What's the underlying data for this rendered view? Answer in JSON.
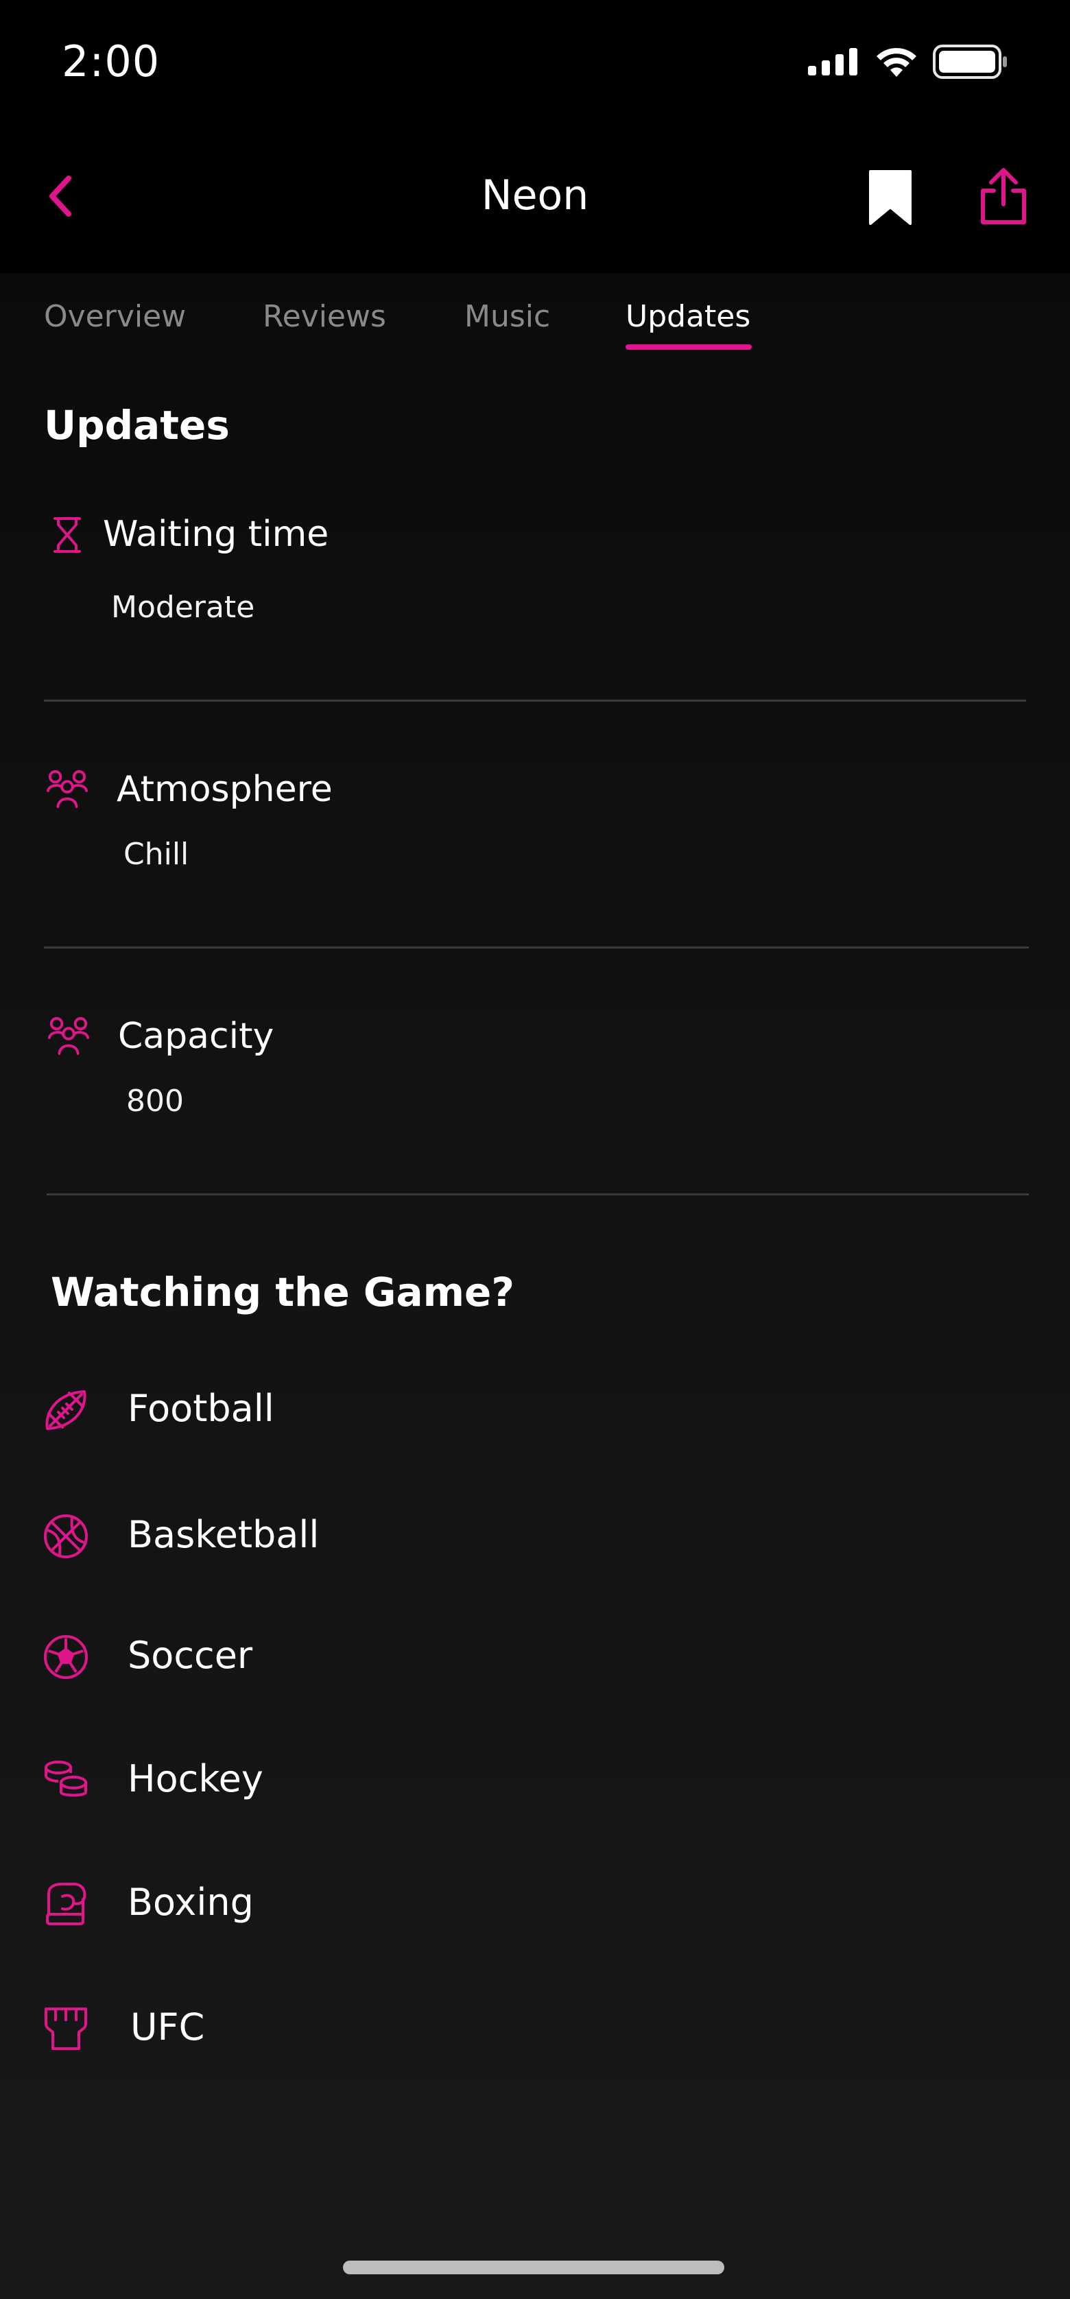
{
  "status_bar": {
    "time": "2:00"
  },
  "nav": {
    "title": "Neon"
  },
  "tabs": [
    {
      "label": "Overview",
      "active": false
    },
    {
      "label": "Reviews",
      "active": false
    },
    {
      "label": "Music",
      "active": false
    },
    {
      "label": "Updates",
      "active": true
    }
  ],
  "updates": {
    "heading": "Updates",
    "items": [
      {
        "label": "Waiting time",
        "value": "Moderate",
        "icon": "hourglass-icon"
      },
      {
        "label": "Atmosphere",
        "value": "Chill",
        "icon": "people-group-icon"
      },
      {
        "label": "Capacity",
        "value": "800",
        "icon": "people-group-icon"
      }
    ]
  },
  "game": {
    "heading": "Watching the Game?",
    "sports": [
      {
        "label": "Football",
        "icon": "football-icon"
      },
      {
        "label": "Basketball",
        "icon": "basketball-icon"
      },
      {
        "label": "Soccer",
        "icon": "soccer-ball-icon"
      },
      {
        "label": "Hockey",
        "icon": "hockey-puck-icon"
      },
      {
        "label": "Boxing",
        "icon": "boxing-glove-icon"
      },
      {
        "label": "UFC",
        "icon": "ufc-glove-icon"
      }
    ]
  },
  "colors": {
    "accent": "#e0158c",
    "background": "#000000",
    "divider": "#3a3a3a"
  }
}
